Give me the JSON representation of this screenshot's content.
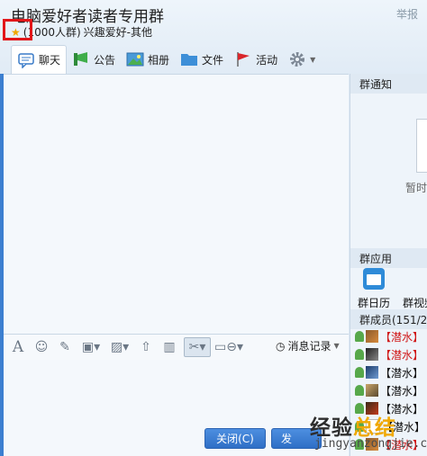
{
  "window": {
    "title": "电脑爱好者读者专用群",
    "report_label": "举报",
    "group_size": "(1000人群)",
    "group_category": "兴趣爱好-其他"
  },
  "tabs": [
    {
      "label": "聊天",
      "icon": "chat-bubble-icon"
    },
    {
      "label": "公告",
      "icon": "megaphone-icon"
    },
    {
      "label": "相册",
      "icon": "photo-album-icon"
    },
    {
      "label": "文件",
      "icon": "folder-icon"
    },
    {
      "label": "活动",
      "icon": "flag-icon"
    }
  ],
  "toolbar": {
    "history_label": "消息记录"
  },
  "buttons": {
    "close": "关闭(C)",
    "send": "发"
  },
  "sidebar": {
    "notice_header": "群通知",
    "notice_empty": "暂时",
    "apps_header": "群应用",
    "apps": [
      "群日历",
      "群视频"
    ],
    "members_header": "群成员(151/2",
    "members": [
      {
        "tag": "【潜水】",
        "red": true
      },
      {
        "tag": "【潜水】",
        "red": true
      },
      {
        "tag": "【潜水】",
        "red": false
      },
      {
        "tag": "【潜水】",
        "red": false
      },
      {
        "tag": "【潜水】",
        "red": false
      },
      {
        "tag": "【潜水】",
        "red": false
      },
      {
        "tag": "【潜水】",
        "red": true
      }
    ]
  },
  "watermark": {
    "brand_black": "经验",
    "brand_gold": "总结",
    "url": "jingyanzongjie.com"
  },
  "colors": {
    "accent": "#3c7fd0",
    "highlight_box": "#e2171a",
    "star": "#f0a800"
  }
}
